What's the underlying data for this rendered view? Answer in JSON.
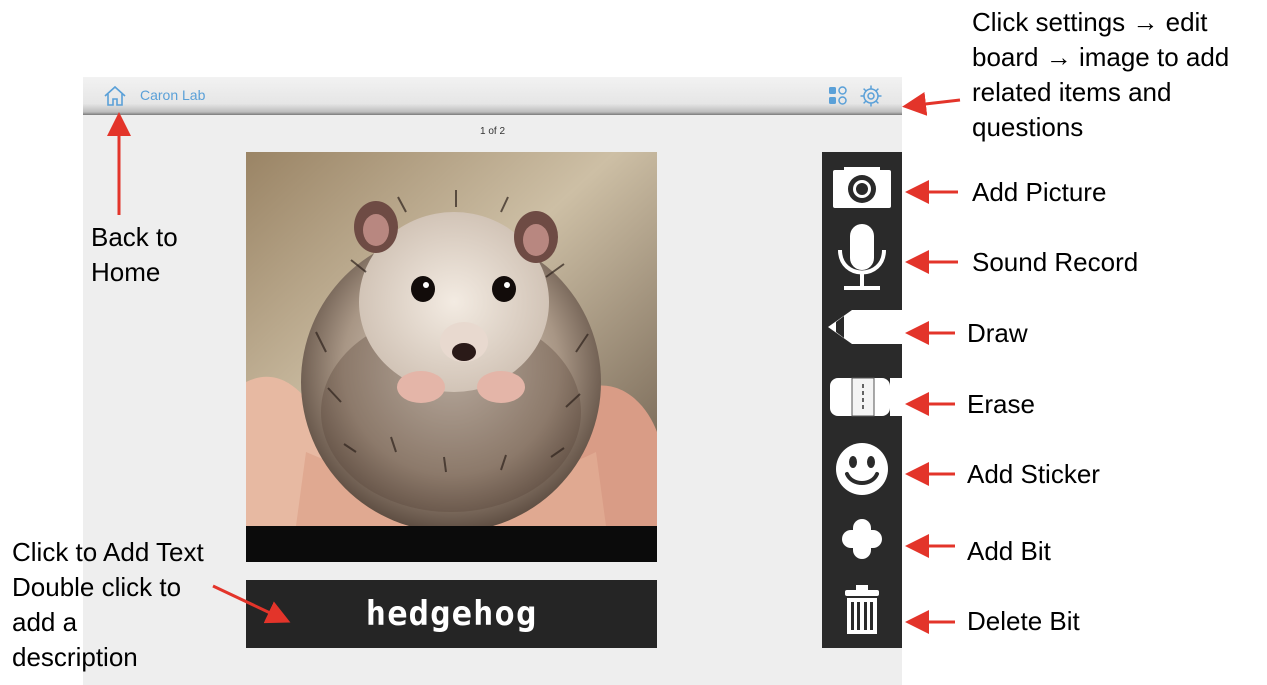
{
  "app": {
    "title": "Caron Lab",
    "page_indicator": "1 of 2",
    "word_label": "hedgehog",
    "accent_color": "#5aa0d8"
  },
  "toolbar": {
    "items": [
      {
        "name": "camera-icon"
      },
      {
        "name": "microphone-icon"
      },
      {
        "name": "pencil-icon"
      },
      {
        "name": "eraser-icon"
      },
      {
        "name": "smiley-icon"
      },
      {
        "name": "plus-icon"
      },
      {
        "name": "trash-icon"
      }
    ]
  },
  "annotations": {
    "settings_note": [
      "Click settings → edit",
      "board → image to add",
      "related items and",
      "questions"
    ],
    "back_home": [
      "Back to",
      "Home"
    ],
    "add_text": [
      "Click to Add Text",
      "Double click to",
      "add a",
      "description"
    ],
    "add_picture": "Add Picture",
    "sound_record": "Sound Record",
    "draw": "Draw",
    "erase": "Erase",
    "add_sticker": "Add Sticker",
    "add_bit": "Add Bit",
    "delete_bit": "Delete Bit",
    "arrow_color": "#e3342a"
  }
}
